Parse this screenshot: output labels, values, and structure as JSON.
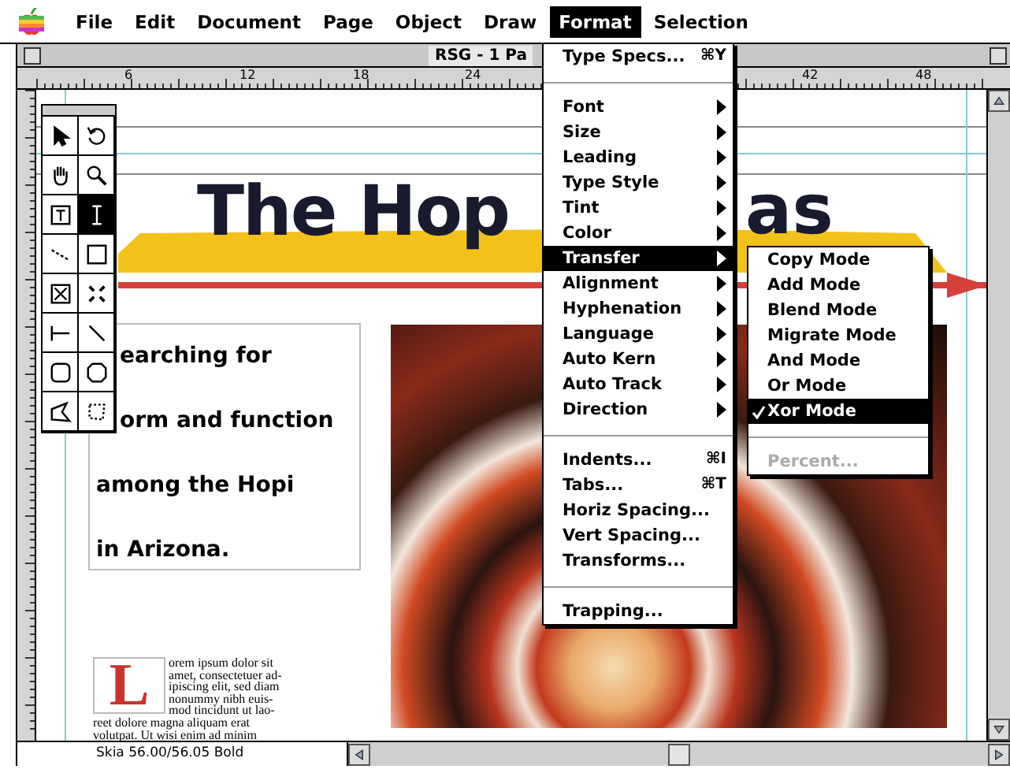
{
  "menu_bar": {
    "items": [
      {
        "label": "File",
        "selected": false
      },
      {
        "label": "Edit",
        "selected": false
      },
      {
        "label": "Document",
        "selected": false
      },
      {
        "label": "Page",
        "selected": false
      },
      {
        "label": "Object",
        "selected": false
      },
      {
        "label": "Draw",
        "selected": false
      },
      {
        "label": "Format",
        "selected": true
      },
      {
        "label": "Selection",
        "selected": false
      }
    ]
  },
  "window": {
    "title": "RSG - 1 Pa"
  },
  "ruler": {
    "labels": [
      "6",
      "12",
      "18",
      "24",
      "42",
      "48"
    ]
  },
  "tools": [
    {
      "selected": false
    },
    {
      "selected": false
    },
    {
      "selected": false
    },
    {
      "selected": false
    },
    {
      "selected": false
    },
    {
      "selected": true
    },
    {
      "selected": false
    },
    {
      "selected": false
    },
    {
      "selected": false
    },
    {
      "selected": false
    },
    {
      "selected": false
    },
    {
      "selected": false
    },
    {
      "selected": false
    },
    {
      "selected": false
    },
    {
      "selected": false
    },
    {
      "selected": false
    }
  ],
  "document": {
    "headline_left": "The Hop",
    "headline_right": "as",
    "pull_quote": [
      "earching for",
      "orm and function",
      "among the Hopi",
      "in Arizona."
    ],
    "drop_cap": "L",
    "body_lines_beside_cap": [
      "orem ipsum dolor sit",
      "amet, consectetuer ad-",
      "ipiscing elit, sed diam",
      "nonummy nibh euis-",
      "mod tincidunt ut lao-"
    ],
    "body_lines_full": [
      "reet dolore magna aliquam erat",
      "volutpat. Ut wisi enim ad minim"
    ]
  },
  "status_bar": {
    "font_info": "Skia 56.00/56.05 Bold"
  },
  "format_menu": {
    "sections": [
      [
        {
          "label": "Type Specs...",
          "shortcut": "⌘Y",
          "has_submenu": false,
          "selected": false
        }
      ],
      [
        {
          "label": "Font",
          "has_submenu": true,
          "selected": false
        },
        {
          "label": "Size",
          "has_submenu": true,
          "selected": false
        },
        {
          "label": "Leading",
          "has_submenu": true,
          "selected": false
        },
        {
          "label": "Type Style",
          "has_submenu": true,
          "selected": false
        },
        {
          "label": "Tint",
          "has_submenu": true,
          "selected": false
        },
        {
          "label": "Color",
          "has_submenu": true,
          "selected": false
        },
        {
          "label": "Transfer",
          "has_submenu": true,
          "selected": true
        },
        {
          "label": "Alignment",
          "has_submenu": true,
          "selected": false
        },
        {
          "label": "Hyphenation",
          "has_submenu": true,
          "selected": false
        },
        {
          "label": "Language",
          "has_submenu": true,
          "selected": false
        },
        {
          "label": "Auto Kern",
          "has_submenu": true,
          "selected": false
        },
        {
          "label": "Auto Track",
          "has_submenu": true,
          "selected": false
        },
        {
          "label": "Direction",
          "has_submenu": true,
          "selected": false
        }
      ],
      [
        {
          "label": "Indents...",
          "shortcut": "⌘I",
          "has_submenu": false,
          "selected": false
        },
        {
          "label": "Tabs...",
          "shortcut": "⌘T",
          "has_submenu": false,
          "selected": false
        },
        {
          "label": "Horiz Spacing...",
          "has_submenu": false,
          "selected": false
        },
        {
          "label": "Vert Spacing...",
          "has_submenu": false,
          "selected": false
        },
        {
          "label": "Transforms...",
          "has_submenu": false,
          "selected": false
        }
      ],
      [
        {
          "label": "Trapping...",
          "has_submenu": false,
          "selected": false
        }
      ]
    ]
  },
  "transfer_submenu": {
    "sections": [
      [
        {
          "label": "Copy Mode",
          "checked": false,
          "selected": false,
          "disabled": false
        },
        {
          "label": "Add Mode",
          "checked": false,
          "selected": false,
          "disabled": false
        },
        {
          "label": "Blend Mode",
          "checked": false,
          "selected": false,
          "disabled": false
        },
        {
          "label": "Migrate Mode",
          "checked": false,
          "selected": false,
          "disabled": false
        },
        {
          "label": "And Mode",
          "checked": false,
          "selected": false,
          "disabled": false
        },
        {
          "label": "Or Mode",
          "checked": false,
          "selected": false,
          "disabled": false
        },
        {
          "label": "Xor Mode",
          "checked": true,
          "selected": true,
          "disabled": false
        }
      ],
      [
        {
          "label": "Percent...",
          "checked": false,
          "selected": false,
          "disabled": true
        }
      ]
    ]
  }
}
